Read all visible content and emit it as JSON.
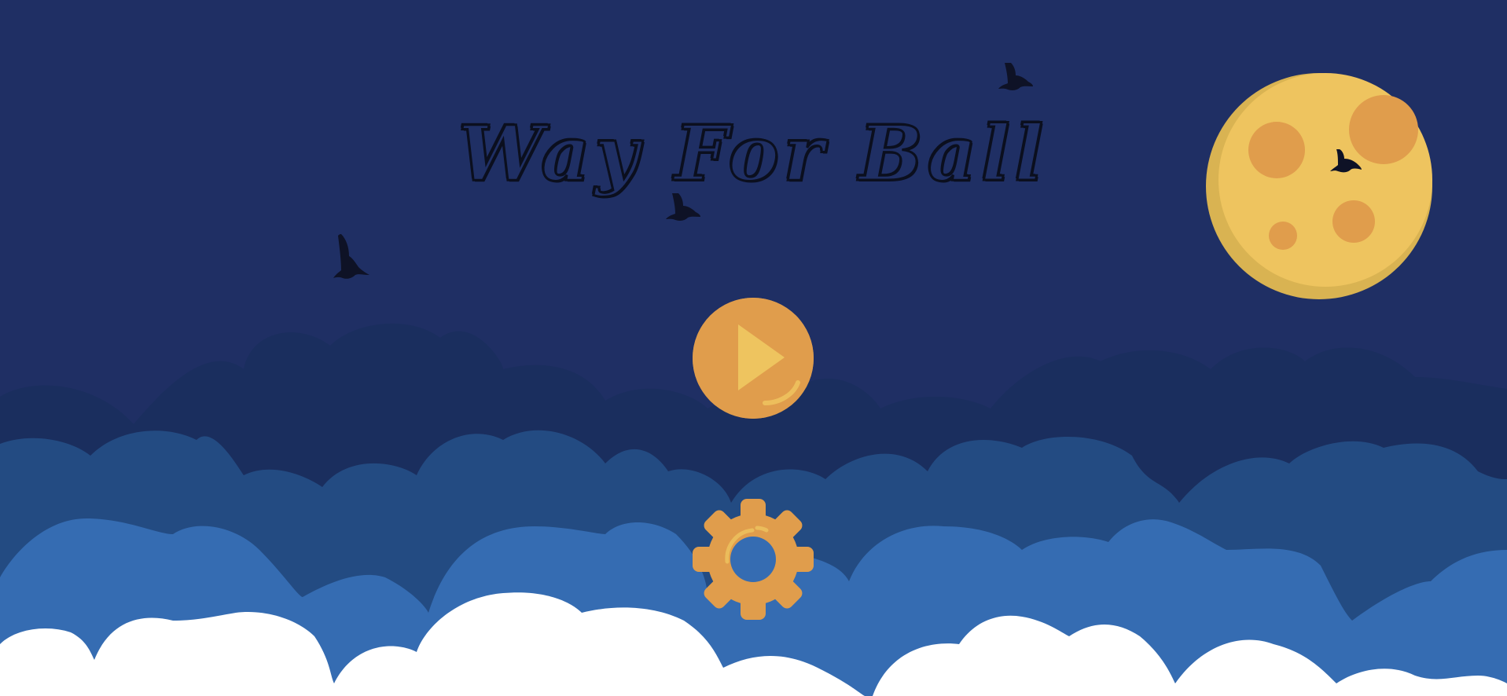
{
  "game": {
    "title": "Way For Ball"
  },
  "menu": {
    "play_icon": "play-icon",
    "settings_icon": "gear-icon"
  },
  "colors": {
    "sky": "#1f2f64",
    "cloud_far": "#1a2e5e",
    "cloud_mid": "#234b82",
    "cloud_near": "#356cb2",
    "cloud_front": "#ffffff",
    "accent_orange": "#e09d4c",
    "accent_yellow": "#eec45f",
    "moon_shadow": "#d9b352",
    "bird": "#0e1226"
  }
}
